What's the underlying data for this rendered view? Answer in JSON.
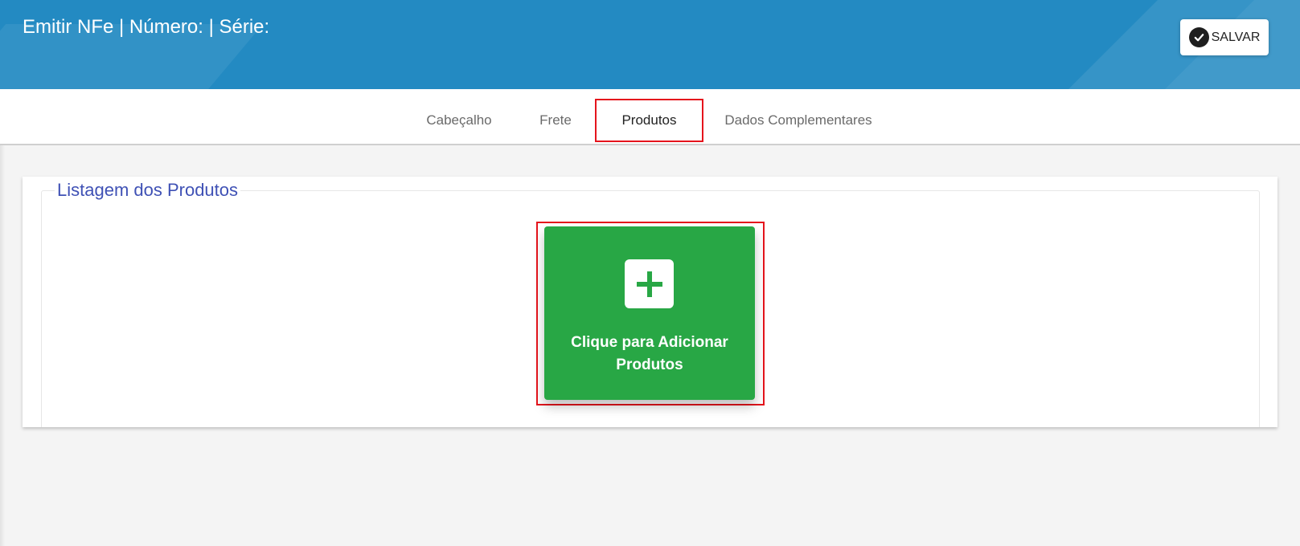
{
  "header": {
    "title": "Emitir NFe | Número: | Série:",
    "save_label": "SALVAR",
    "save_icon": "check-circle-icon",
    "background_color": "#238ac2"
  },
  "tabs": [
    {
      "label": "Cabeçalho",
      "active": false
    },
    {
      "label": "Frete",
      "active": false
    },
    {
      "label": "Produtos",
      "active": true
    },
    {
      "label": "Dados Complementares",
      "active": false
    }
  ],
  "products": {
    "section_title": "Listagem dos Produtos",
    "add_button": {
      "label_line1": "Clique para Adicionar",
      "label_line2": "Produtos",
      "icon": "plus-icon",
      "color": "#28a745"
    }
  },
  "colors": {
    "highlight": "#e5141c",
    "section_title": "#3f51b5"
  }
}
